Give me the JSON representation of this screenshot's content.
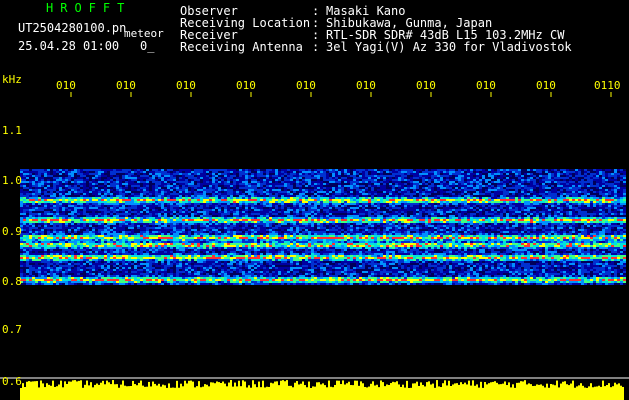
{
  "header": {
    "app_title": "HROFFT",
    "filename": "UT2504280100.pn",
    "mode": "meteor",
    "datetime": "25.04.28 01:00",
    "frame_no": "0_"
  },
  "metadata": [
    {
      "label": "Observer",
      "value": "Masaki Kano"
    },
    {
      "label": "Receiving Location",
      "value": "Shibukawa, Gunma, Japan"
    },
    {
      "label": "Receiver",
      "value": "RTL-SDR SDR# 43dB L15 103.2MHz CW"
    },
    {
      "label": "Receiving Antenna",
      "value": "3el Yagi(V) Az 330 for Vladivostok"
    }
  ],
  "colors": {
    "background": "#000000",
    "title": "#00ff00",
    "text": "#ffffff",
    "axis_labels": "#ffff00",
    "baseline": "#ffffff",
    "spectrum_bars": "#ffff00"
  },
  "chart_data": {
    "type": "heatmap",
    "ylabel": "kHz",
    "y_ticks": [
      "0.6",
      "0.7",
      "0.8",
      "0.9",
      "1.0",
      "1.1"
    ],
    "ylim": [
      0.6,
      1.2
    ],
    "x_ticks": [
      "010",
      "010",
      "010",
      "010",
      "010",
      "010",
      "010",
      "010",
      "010",
      "0110"
    ],
    "signal_band": [
      0.79,
      1.02
    ],
    "strong_bands_khz": [
      0.8,
      0.845,
      0.87,
      0.885,
      0.92,
      0.96
    ],
    "grid": false
  }
}
